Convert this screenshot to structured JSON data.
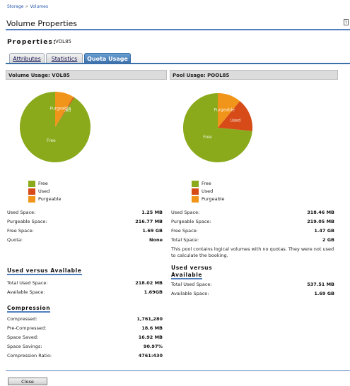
{
  "breadcrumb": {
    "storage": "Storage",
    "separator": ">",
    "volumes": "Volumes"
  },
  "page": {
    "title": "Volume Properties",
    "help_glyph": "?"
  },
  "properties": {
    "heading": "Properties:",
    "volume_name": "VOL85"
  },
  "tabs": [
    {
      "label": "Attributes",
      "active": false
    },
    {
      "label": "Statistics",
      "active": false
    },
    {
      "label": "Quota Usage",
      "active": true
    }
  ],
  "colors": {
    "free": "#8aaa1c",
    "used": "#d64b17",
    "purgeable": "#f0951a",
    "accent": "#4f7fbf"
  },
  "volume_usage": {
    "header_label": "Volume Usage:",
    "header_name": "VOL85",
    "pie": [
      {
        "name": "Free",
        "fraction": 0.909
      },
      {
        "name": "Used",
        "fraction": 0.005
      },
      {
        "name": "Purgeable",
        "fraction": 0.086
      }
    ],
    "legend": [
      "Free",
      "Used",
      "Purgeable"
    ],
    "stats": [
      {
        "label": "Used Space:",
        "value": "1.25 MB"
      },
      {
        "label": "Purgeable Space:",
        "value": "216.77 MB"
      },
      {
        "label": "Free Space:",
        "value": "1.69 GB"
      },
      {
        "label": "Quota:",
        "value": "None"
      }
    ],
    "used_vs_available": {
      "title": "Used versus Available",
      "rows": [
        {
          "label": "Total Used Space:",
          "value": "218.02 MB"
        },
        {
          "label": "Available Space:",
          "value": "1.69GB"
        }
      ]
    },
    "compression": {
      "title": "Compression",
      "rows": [
        {
          "label": "Compressed:",
          "value": "1,761,280"
        },
        {
          "label": "Pre-Compressed:",
          "value": "18.6 MB"
        },
        {
          "label": "Space Saved:",
          "value": "16.92 MB"
        },
        {
          "label": "Space Savings:",
          "value": "90.97%"
        },
        {
          "label": "Compression Ratio:",
          "value": "4761:430"
        }
      ]
    }
  },
  "pool_usage": {
    "header_label": "Pool Usage:",
    "header_name": "POOL85",
    "pie": [
      {
        "name": "Free",
        "fraction": 0.735
      },
      {
        "name": "Used",
        "fraction": 0.155
      },
      {
        "name": "Purgeable",
        "fraction": 0.11
      }
    ],
    "legend": [
      "Free",
      "Used",
      "Purgeable"
    ],
    "stats": [
      {
        "label": "Used Space:",
        "value": "318.46 MB"
      },
      {
        "label": "Purgeable Space:",
        "value": "219.05 MB"
      },
      {
        "label": "Free Space:",
        "value": "1.47 GB"
      },
      {
        "label": "Total Space:",
        "value": "2 GB"
      }
    ],
    "note": "This pool contains logical volumes with no quotas. They were not used to calculate the booking.",
    "used_vs_available": {
      "title_line1": "Used versus",
      "title_line2": "Available",
      "rows": [
        {
          "label": "Total Used Space:",
          "value": "537.51 MB"
        },
        {
          "label": "Available Space:",
          "value": "1.69 GB"
        }
      ]
    }
  },
  "footer": {
    "close_label": "Close"
  }
}
